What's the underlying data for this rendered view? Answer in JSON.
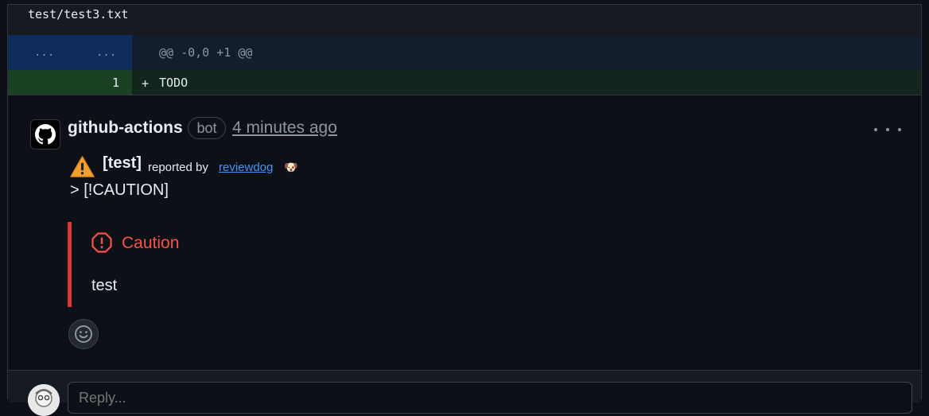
{
  "file": {
    "name": "test/test3.txt"
  },
  "diff": {
    "hunk": {
      "old_gutter": "...",
      "new_gutter": "...",
      "header": "@@ -0,0 +1 @@"
    },
    "added_line": {
      "number": "1",
      "sign": "+",
      "code": "TODO"
    }
  },
  "comment": {
    "author": "github-actions",
    "badge": "bot",
    "timestamp": "4 minutes ago",
    "tag": "[test]",
    "reported_by": "reported by",
    "reporter_link": "reviewdog",
    "dog_emoji": "🐶",
    "quote_line": "> [!CAUTION]",
    "alert": {
      "title": "Caution",
      "body": "test",
      "color": "#da3633"
    }
  },
  "reply": {
    "placeholder": "Reply..."
  },
  "colors": {
    "bg": "#0d1117",
    "link": "#4493f8",
    "caution": "#f85149",
    "warning": "#d29922"
  }
}
